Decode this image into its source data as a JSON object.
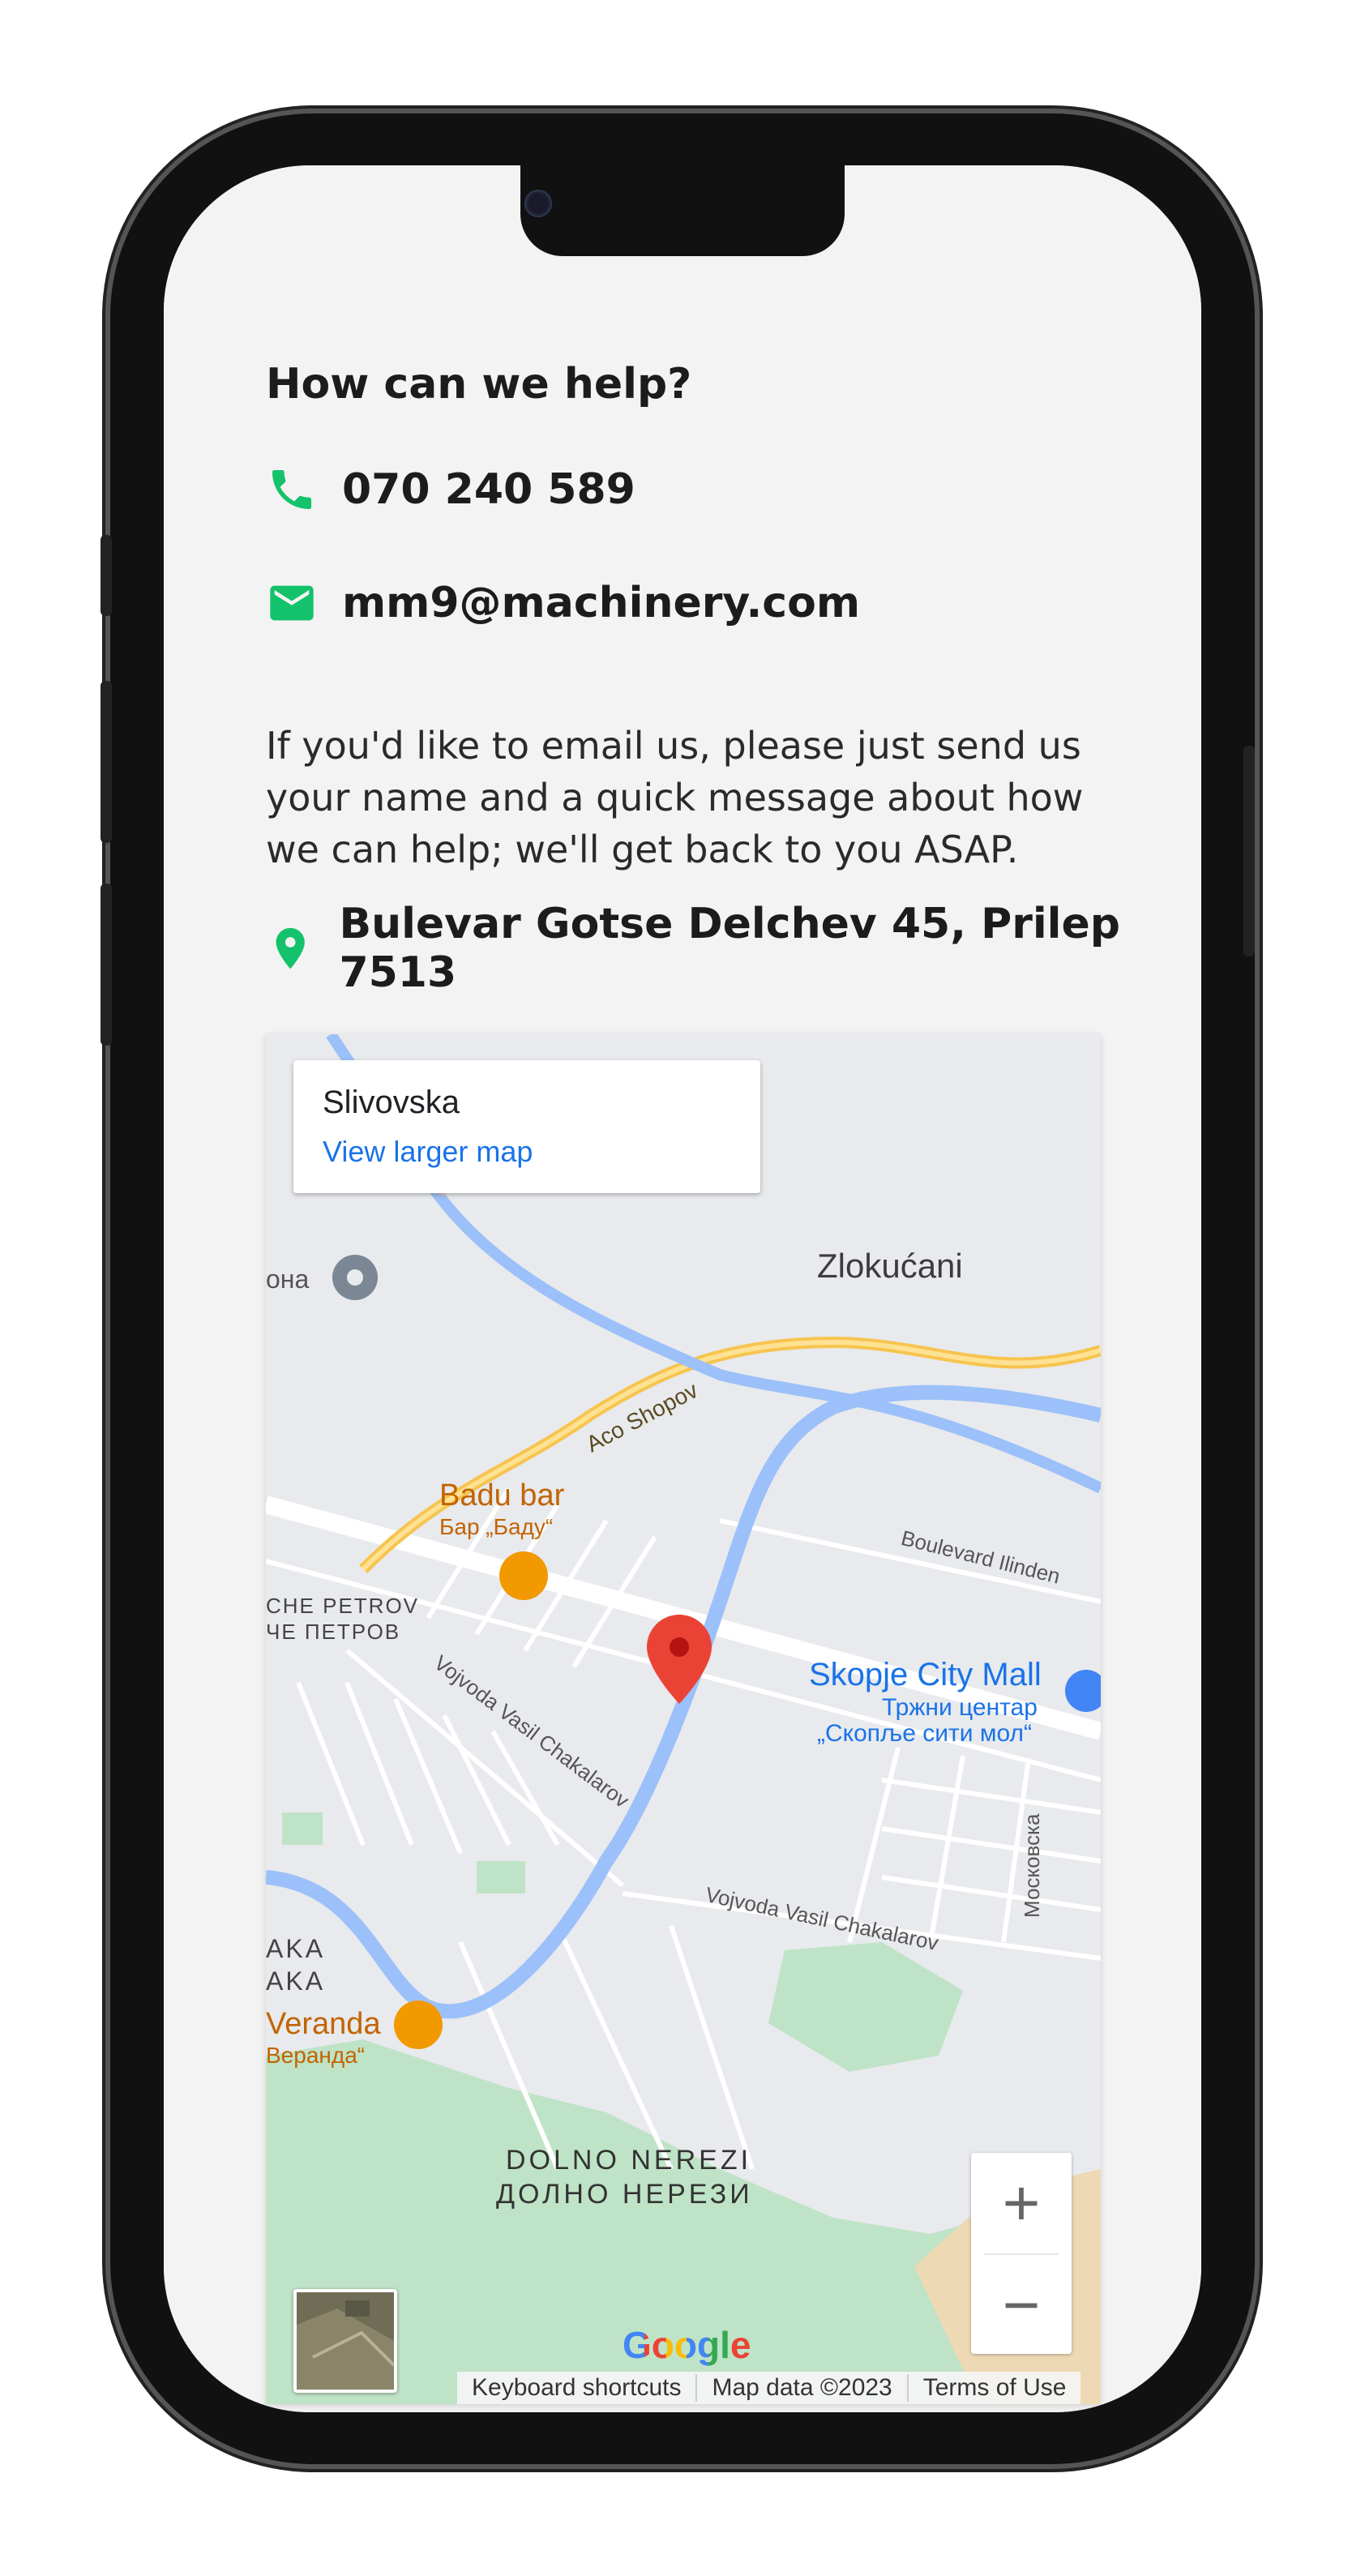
{
  "contact": {
    "heading": "How can we help?",
    "phone": "070 240 589",
    "email": "mm9@machinery.com",
    "message": "If you'd like to email us, please just send us your name and a quick message about how we can help; we'll get back to you ASAP.",
    "address": "Bulevar Gotse Delchev 45, Prilep 7513"
  },
  "map": {
    "place_name": "Slivovska",
    "view_larger": "View larger map",
    "labels": {
      "zlokukani": "Zlokućani",
      "aco_shopov": "Aco Shopov",
      "badu_bar": "Badu bar",
      "badu_bar_cyr": "Бар „Баду“",
      "che_petrov": "CHE PETROV",
      "che_petrov_cyr": "ЧЕ ПЕТРОВ",
      "vojvoda_1": "Vojvoda Vasil Chakalarov",
      "vojvoda_2": "Vojvoda Vasil Chakalarov",
      "boulevard_ilinden": "Boulevard Ilinden",
      "skopje_city_mall": "Skopje City Mall",
      "mall_cyr_1": "Тржни центар",
      "mall_cyr_2": "„Скопље сити мол“",
      "moskovska": "Московска",
      "aka_1": "AKA",
      "aka_2": "AKA",
      "veranda": "Veranda",
      "veranda_cyr": "Веранда“",
      "dolno_nerezi": "DOLNO NEREZI",
      "dolno_nerezi_cyr": "ДОЛНО НЕРЕЗИ",
      "ona": "она"
    },
    "zoom_in": "+",
    "zoom_out": "−",
    "google_logo": "Google",
    "attribution": {
      "shortcuts": "Keyboard shortcuts",
      "map_data": "Map data ©2023",
      "terms": "Terms of Use"
    }
  },
  "colors": {
    "accent_green": "#13c26b",
    "water": "#9cc0f9",
    "park": "#bfe3c6",
    "highway": "#f7c44f",
    "pin_red": "#ea4335",
    "link_blue": "#1a73e8"
  }
}
